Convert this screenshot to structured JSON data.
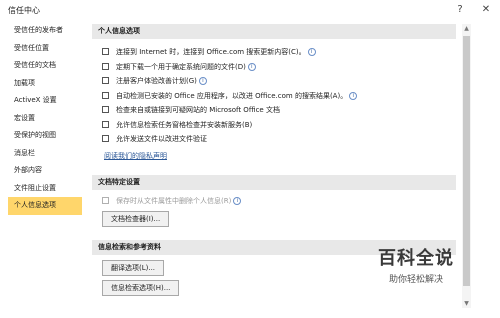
{
  "window": {
    "title": "信任中心",
    "help_icon": "?",
    "close_icon": "✕"
  },
  "sidebar": {
    "items": [
      {
        "label": "受信任的发布者"
      },
      {
        "label": "受信任位置"
      },
      {
        "label": "受信任的文档"
      },
      {
        "label": "加载项"
      },
      {
        "label": "ActiveX 设置"
      },
      {
        "label": "宏设置"
      },
      {
        "label": "受保护的视图"
      },
      {
        "label": "消息栏"
      },
      {
        "label": "外部内容"
      },
      {
        "label": "文件阻止设置"
      },
      {
        "label": "个人信息选项"
      }
    ],
    "active_index": 10
  },
  "privacy": {
    "header": "个人信息选项",
    "options": [
      {
        "label": "连接到 Internet 时，连接到 Office.com 搜索更新内容(C)。",
        "checked": false
      },
      {
        "label": "定期下载一个用于确定系统问题的文件(D)",
        "checked": false
      },
      {
        "label": "注册客户体验改善计划(G)",
        "checked": false
      },
      {
        "label": "自动检测已安装的 Office 应用程序，以改进 Office.com 的搜索结果(A)。",
        "checked": false
      },
      {
        "label": "检查来自或链接到可疑网站的 Microsoft Office 文档",
        "checked": false
      },
      {
        "label": "允许信息检索任务窗格检查并安装新服务(B)",
        "checked": false
      },
      {
        "label": "允许发送文件以改进文件验证",
        "checked": false
      }
    ],
    "privacy_link": "阅读我们的隐私声明"
  },
  "doc_settings": {
    "header": "文档特定设置",
    "option": "保存时从文件属性中删除个人信息(R)",
    "inspector_button": "文档检查器(I)..."
  },
  "research": {
    "header": "信息检索和参考资料",
    "translate_button": "翻译选项(L)...",
    "research_button": "信息检索选项(H)..."
  },
  "watermark": {
    "main": "百科全说",
    "sub": "助你轻松解决"
  }
}
